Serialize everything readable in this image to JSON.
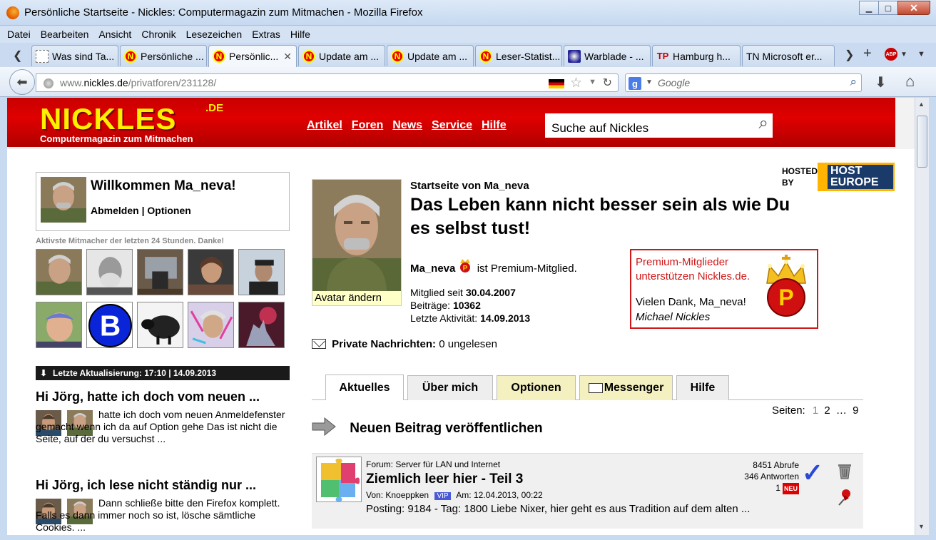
{
  "window": {
    "title": "Persönliche Startseite - Nickles: Computermagazin zum Mitmachen - Mozilla Firefox"
  },
  "menu": [
    "Datei",
    "Bearbeiten",
    "Ansicht",
    "Chronik",
    "Lesezeichen",
    "Extras",
    "Hilfe"
  ],
  "tabs": [
    {
      "label": "Was sind Ta...",
      "icon": "blank"
    },
    {
      "label": "Persönliche ...",
      "icon": "nickles"
    },
    {
      "label": "Persönlic...",
      "icon": "nickles",
      "active": true
    },
    {
      "label": "Update am ...",
      "icon": "nickles"
    },
    {
      "label": "Update am ...",
      "icon": "nickles"
    },
    {
      "label": "Leser-Statist...",
      "icon": "nickles"
    },
    {
      "label": "Warblade - ...",
      "icon": "warblade"
    },
    {
      "label": "Hamburg h...",
      "icon": "tp"
    },
    {
      "label": "TN Microsoft er...",
      "icon": "none"
    }
  ],
  "addon": {
    "abp_label": "ABP"
  },
  "nav": {
    "url_prefix": "www.",
    "url_domain": "nickles.de",
    "url_path": "/privatforen/231128/",
    "search_placeholder": "Google"
  },
  "site": {
    "logo": "NICKLES",
    "logo_tld": ".DE",
    "tagline": "Computermagazin zum Mitmachen",
    "nav": [
      "Artikel",
      "Foren",
      "News",
      "Service",
      "Hilfe"
    ],
    "search_placeholder": "Suche auf Nickles",
    "hosted_by": "HOSTED BY",
    "host_logo_1": "HOST",
    "host_logo_2": "EUROPE"
  },
  "sidebar": {
    "welcome": "Willkommen Ma_neva!",
    "logout": "Abmelden",
    "separator": "|",
    "options": "Optionen",
    "active_label": "Aktivste Mitmacher der letzten 24 Stunden. Danke!",
    "update_bar": "Letzte Aktualisierung: 17:10 | 14.09.2013",
    "posts": [
      {
        "title": "Hi Jörg, hatte ich doch vom neuen ...",
        "text": "hatte ich doch vom neuen Anmeldefenster gemacht wenn ich da auf Option gehe Das ist nicht die Seite, auf der du versuchst ..."
      },
      {
        "title": "Hi Jörg, ich lese nicht ständig nur ...",
        "text": "Dann schließe bitte den Firefox komplett. Falls es dann immer noch so ist, lösche sämtliche Cookies. ..."
      }
    ]
  },
  "profile": {
    "avatar_caption": "Avatar ändern",
    "home_of": "Startseite von Ma_neva",
    "slogan": "Das Leben kann nicht besser sein als wie Du es selbst tust!",
    "username": "Ma_neva",
    "status": "ist Premium-Mitglied.",
    "member_since_label": "Mitglied seit",
    "member_since": "30.04.2007",
    "posts_label": "Beiträge:",
    "posts": "10362",
    "last_activity_label": "Letzte Aktivität:",
    "last_activity": "14.09.2013",
    "pm_label": "Private Nachrichten:",
    "pm_value": "0 ungelesen"
  },
  "premium_box": {
    "line1": "Premium-Mitglieder unterstützen Nickles.de.",
    "thanks": "Vielen Dank, Ma_neva!",
    "signature": "Michael Nickles"
  },
  "profile_tabs": [
    "Aktuelles",
    "Über mich",
    "Optionen",
    "Messenger",
    "Hilfe"
  ],
  "pagination": {
    "label": "Seiten:",
    "pages": [
      "1",
      "2",
      "…",
      "9"
    ]
  },
  "new_post": "Neuen Beitrag veröffentlichen",
  "forum_entry": {
    "forum": "Forum: Server für LAN und Internet",
    "title": "Ziemlich leer hier - Teil 3",
    "author_label": "Von:",
    "author": "Knoeppken",
    "vip": "VIP",
    "date": "Am: 12.04.2013, 00:22",
    "posting": "Posting: 9184 - Tag: 1800 Liebe Nixer, hier geht es aus Tradition auf dem alten ...",
    "views": "8451 Abrufe",
    "replies": "346 Antworten",
    "new_count": "1",
    "new_badge": "NEU"
  },
  "colors": {
    "nickles_red": "#d00000",
    "logo_yellow": "#ffef00",
    "premium_red": "#d01818",
    "tab_yellow": "#f4f0c0"
  }
}
